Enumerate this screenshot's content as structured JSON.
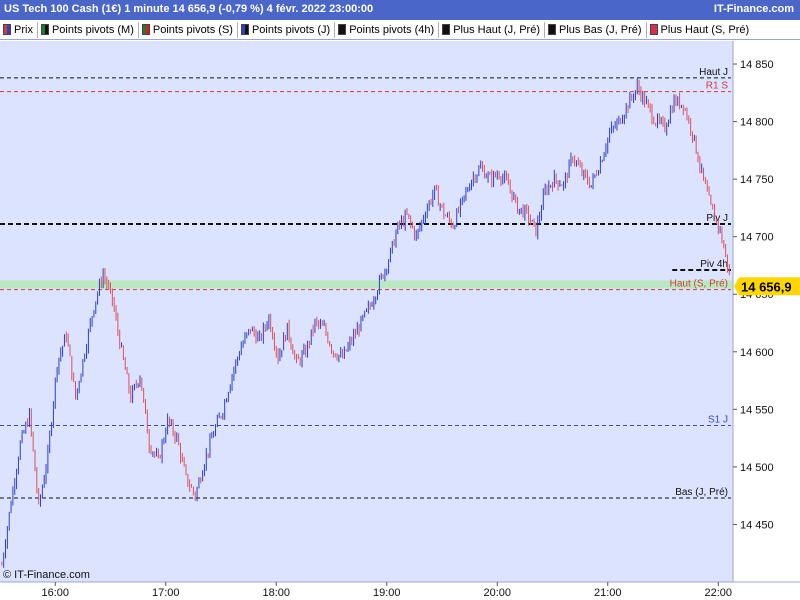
{
  "header": {
    "title": "US Tech 100 Cash (1€) 1 minute 14 656,9 (-0,79 %) 4 févr. 2022 23:00:00",
    "site": "IT-Finance.com"
  },
  "legend": [
    {
      "label": "Prix",
      "colors": [
        "#d63a3a",
        "#2f3fc8"
      ]
    },
    {
      "label": "Points pivots (M)",
      "colors": [
        "#1a7f2a",
        "#111111"
      ]
    },
    {
      "label": "Points pivots (S)",
      "colors": [
        "#1a7f2a",
        "#d22020"
      ]
    },
    {
      "label": "Points pivots (J)",
      "colors": [
        "#2f3fc8",
        "#111111"
      ]
    },
    {
      "label": "Points pivots (4h)",
      "colors": [
        "#111111"
      ]
    },
    {
      "label": "Plus Haut (J, Pré)",
      "colors": [
        "#111111"
      ]
    },
    {
      "label": "Plus Bas (J, Pré)",
      "colors": [
        "#111111"
      ]
    },
    {
      "label": "Plus Haut (S, Pré)",
      "colors": [
        "#d6304a"
      ]
    }
  ],
  "copyright": "© IT-Finance.com",
  "chart_data": {
    "type": "candlestick",
    "title": "US Tech 100 Cash (1€) 1 minute",
    "last_price_label": "14 656,9",
    "last_price": 14656.9,
    "ylim": [
      14400,
      14870
    ],
    "xlim": [
      "15:30",
      "22:08"
    ],
    "y_ticks": [
      {
        "value": 14450,
        "label": "14 450"
      },
      {
        "value": 14500,
        "label": "14 500"
      },
      {
        "value": 14550,
        "label": "14 550"
      },
      {
        "value": 14600,
        "label": "14 600"
      },
      {
        "value": 14650,
        "label": "14 650"
      },
      {
        "value": 14700,
        "label": "14 700"
      },
      {
        "value": 14750,
        "label": "14 750"
      },
      {
        "value": 14800,
        "label": "14 800"
      },
      {
        "value": 14850,
        "label": "14 850"
      }
    ],
    "x_ticks": [
      {
        "time": "16:00",
        "label": "16:00"
      },
      {
        "time": "17:00",
        "label": "17:00"
      },
      {
        "time": "18:00",
        "label": "18:00"
      },
      {
        "time": "19:00",
        "label": "19:00"
      },
      {
        "time": "20:00",
        "label": "20:00"
      },
      {
        "time": "21:00",
        "label": "21:00"
      },
      {
        "time": "22:00",
        "label": "22:00"
      }
    ],
    "levels": [
      {
        "label": "Haut J",
        "value": 14838,
        "color": "#111111",
        "dash": "4,3",
        "width": 1,
        "label_color": "#111111"
      },
      {
        "label": "R1 S",
        "value": 14826,
        "color": "#d63a3a",
        "dash": "4,3",
        "width": 1,
        "label_color": "#d63a3a"
      },
      {
        "label": "Piv J",
        "value": 14711,
        "color": "#111111",
        "dash": "5,3",
        "width": 2,
        "label_color": "#111111"
      },
      {
        "label": "Piv 4h",
        "value": 14671,
        "color": "#111111",
        "dash": "5,3",
        "width": 2,
        "from": "21:35",
        "label_color": "#111111"
      },
      {
        "label": "Haut (S, Pré)",
        "value": 14654,
        "color": "#d63a3a",
        "dash": "4,3",
        "width": 1,
        "label_color": "#d63a3a"
      },
      {
        "label": "S1 J",
        "value": 14536,
        "color": "#3a4bc8",
        "dash": "4,3",
        "width": 1,
        "label_color": "#3a4bc8"
      },
      {
        "label": "Bas (J, Pré)",
        "value": 14473,
        "color": "#111111",
        "dash": "4,3",
        "width": 1,
        "label_color": "#111111"
      }
    ],
    "zone": {
      "from": 14655,
      "to": 14662,
      "color": "#b9e8c2"
    },
    "path": [
      [
        "15:31",
        14415
      ],
      [
        "15:36",
        14470
      ],
      [
        "15:41",
        14520
      ],
      [
        "15:46",
        14545
      ],
      [
        "15:51",
        14465
      ],
      [
        "15:56",
        14510
      ],
      [
        "16:01",
        14590
      ],
      [
        "16:06",
        14615
      ],
      [
        "16:11",
        14560
      ],
      [
        "16:16",
        14600
      ],
      [
        "16:21",
        14640
      ],
      [
        "16:26",
        14668
      ],
      [
        "16:31",
        14645
      ],
      [
        "16:36",
        14600
      ],
      [
        "16:41",
        14560
      ],
      [
        "16:46",
        14580
      ],
      [
        "16:51",
        14520
      ],
      [
        "16:56",
        14505
      ],
      [
        "17:01",
        14540
      ],
      [
        "17:06",
        14525
      ],
      [
        "17:11",
        14490
      ],
      [
        "17:16",
        14475
      ],
      [
        "17:21",
        14505
      ],
      [
        "17:26",
        14530
      ],
      [
        "17:31",
        14550
      ],
      [
        "17:36",
        14580
      ],
      [
        "17:41",
        14605
      ],
      [
        "17:46",
        14620
      ],
      [
        "17:51",
        14610
      ],
      [
        "17:56",
        14630
      ],
      [
        "18:01",
        14595
      ],
      [
        "18:06",
        14620
      ],
      [
        "18:11",
        14590
      ],
      [
        "18:16",
        14600
      ],
      [
        "18:21",
        14625
      ],
      [
        "18:26",
        14620
      ],
      [
        "18:31",
        14600
      ],
      [
        "18:36",
        14595
      ],
      [
        "18:41",
        14610
      ],
      [
        "18:46",
        14625
      ],
      [
        "18:51",
        14640
      ],
      [
        "18:56",
        14660
      ],
      [
        "19:01",
        14680
      ],
      [
        "19:06",
        14708
      ],
      [
        "19:11",
        14718
      ],
      [
        "19:16",
        14700
      ],
      [
        "19:21",
        14722
      ],
      [
        "19:26",
        14740
      ],
      [
        "19:31",
        14720
      ],
      [
        "19:36",
        14710
      ],
      [
        "19:41",
        14730
      ],
      [
        "19:46",
        14750
      ],
      [
        "19:51",
        14760
      ],
      [
        "19:56",
        14750
      ],
      [
        "20:01",
        14755
      ],
      [
        "20:06",
        14745
      ],
      [
        "20:11",
        14725
      ],
      [
        "20:16",
        14720
      ],
      [
        "20:21",
        14705
      ],
      [
        "20:26",
        14740
      ],
      [
        "20:31",
        14750
      ],
      [
        "20:36",
        14745
      ],
      [
        "20:41",
        14770
      ],
      [
        "20:46",
        14755
      ],
      [
        "20:51",
        14745
      ],
      [
        "20:56",
        14765
      ],
      [
        "21:01",
        14790
      ],
      [
        "21:06",
        14800
      ],
      [
        "21:11",
        14815
      ],
      [
        "21:16",
        14830
      ],
      [
        "21:21",
        14815
      ],
      [
        "21:26",
        14800
      ],
      [
        "21:31",
        14795
      ],
      [
        "21:36",
        14818
      ],
      [
        "21:41",
        14815
      ],
      [
        "21:46",
        14790
      ],
      [
        "21:51",
        14755
      ],
      [
        "21:56",
        14725
      ],
      [
        "22:01",
        14705
      ],
      [
        "22:06",
        14668
      ]
    ]
  }
}
